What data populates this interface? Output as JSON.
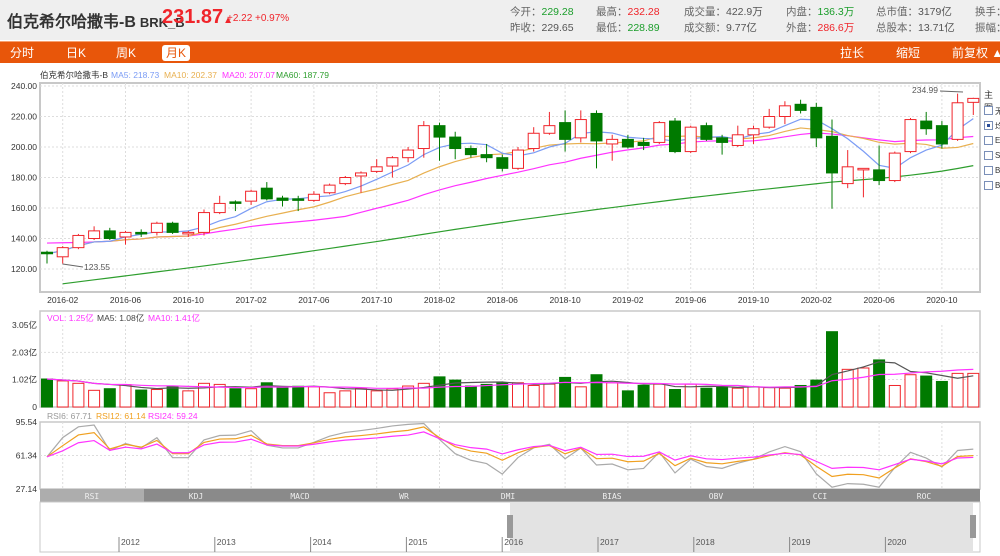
{
  "header": {
    "name": "伯克希尔哈撒韦-B",
    "code": "BRK_B",
    "price": "231.87",
    "arrow": "▲",
    "change": "+2.22",
    "change_pct": "+0.97%",
    "stats": [
      {
        "label": "今开：",
        "value": "229.28",
        "color": "g"
      },
      {
        "label": "昨收：",
        "value": "229.65",
        "color": "k"
      },
      {
        "label": "最高：",
        "value": "232.28",
        "color": "r"
      },
      {
        "label": "最低：",
        "value": "228.89",
        "color": "g"
      },
      {
        "label": "成交量：",
        "value": "422.9万",
        "color": "k"
      },
      {
        "label": "成交额：",
        "value": "9.77亿",
        "color": "k"
      },
      {
        "label": "内盘：",
        "value": "136.3万",
        "color": "g"
      },
      {
        "label": "外盘：",
        "value": "286.6万",
        "color": "r"
      },
      {
        "label": "总市值：",
        "value": "3179亿",
        "color": "k"
      },
      {
        "label": "总股本：",
        "value": "13.71亿",
        "color": "k"
      },
      {
        "label": "换手：",
        "value": "",
        "color": "k"
      },
      {
        "label": "振幅：",
        "value": "",
        "color": "k"
      }
    ]
  },
  "toolbar": {
    "tabs": [
      "分时",
      "日K",
      "周K",
      "月K"
    ],
    "active": 3,
    "stretch": "拉长",
    "shrink": "缩短",
    "adjust": "前复权 ▲"
  },
  "side": {
    "title": "主图",
    "options": [
      "无",
      "均",
      "EX",
      "SA",
      "BO",
      "BB"
    ],
    "checked": 1
  },
  "legend": {
    "name": "伯克希尔哈撒韦-B",
    "ma5": "MA5: 218.73",
    "ma10": "MA10: 202.37",
    "ma20": "MA20: 207.07",
    "ma60": "MA60: 187.79"
  },
  "vol_legend": {
    "vol": "VOL: 1.25亿",
    "ma5": "MA5: 1.08亿",
    "ma10": "MA10: 1.41亿"
  },
  "rsi_legend": {
    "rsi6": "RSI6: 67.71",
    "rsi12": "RSI12: 61.14",
    "rsi24": "RSI24: 59.24"
  },
  "indicators": [
    "RSI",
    "KDJ",
    "MACD",
    "WR",
    "DMI",
    "BIAS",
    "OBV",
    "CCI",
    "ROC"
  ],
  "navigator_years": [
    "2012",
    "2013",
    "2014",
    "2015",
    "2016",
    "2017",
    "2018",
    "2019",
    "2020"
  ],
  "colors": {
    "up": "#f0252b",
    "down": "#007a00",
    "ma5": "#7b9cf5",
    "ma10": "#e8b050",
    "ma20": "#ff33ff",
    "ma60": "#2e9e2e",
    "accent": "#e8560a"
  },
  "chart_data": {
    "type": "candlestick",
    "x_ticks": [
      "2016-02",
      "2016-06",
      "2016-10",
      "2017-02",
      "2017-06",
      "2017-10",
      "2018-02",
      "2018-06",
      "2018-10",
      "2019-02",
      "2019-06",
      "2019-10",
      "2020-02",
      "2020-06",
      "2020-10"
    ],
    "y_ticks": [
      "240.00",
      "220.00",
      "200.00",
      "180.00",
      "160.00",
      "140.00",
      "120.00"
    ],
    "ylim": [
      110,
      240
    ],
    "annotations": {
      "max": "234.99",
      "min": "123.55"
    },
    "ohlc": [
      [
        131,
        130,
        132,
        123.6
      ],
      [
        128,
        134,
        135,
        123.55
      ],
      [
        134,
        142,
        143,
        133
      ],
      [
        140,
        145,
        148,
        139
      ],
      [
        145,
        140,
        147,
        139
      ],
      [
        141,
        144,
        145,
        136
      ],
      [
        144,
        143,
        146,
        141
      ],
      [
        144,
        150,
        151,
        142
      ],
      [
        150,
        144,
        151,
        143
      ],
      [
        143,
        144,
        145,
        141
      ],
      [
        144,
        157,
        159,
        142
      ],
      [
        157,
        163,
        168,
        156
      ],
      [
        164,
        163.5,
        165,
        158
      ],
      [
        164.5,
        171,
        172,
        162
      ],
      [
        173,
        166,
        177,
        165
      ],
      [
        166.5,
        165,
        168,
        161
      ],
      [
        166,
        165,
        168,
        158
      ],
      [
        165,
        169,
        171,
        164
      ],
      [
        170,
        175,
        176,
        169
      ],
      [
        176,
        180,
        181,
        175
      ],
      [
        181,
        183,
        184,
        170
      ],
      [
        184,
        187,
        192,
        183
      ],
      [
        187.5,
        193,
        194,
        180
      ],
      [
        193,
        198,
        200,
        190
      ],
      [
        199,
        214,
        217,
        193
      ],
      [
        214,
        206.5,
        216,
        191
      ],
      [
        206.5,
        199,
        210,
        192
      ],
      [
        199,
        195,
        201,
        193
      ],
      [
        195,
        193,
        202,
        190
      ],
      [
        193,
        186,
        195,
        184
      ],
      [
        186,
        198,
        200,
        185
      ],
      [
        199,
        209,
        213,
        197
      ],
      [
        209,
        214,
        223,
        208
      ],
      [
        216,
        205,
        224,
        197
      ],
      [
        206,
        218,
        224,
        203
      ],
      [
        222,
        204,
        224,
        186
      ],
      [
        202,
        205,
        208,
        191
      ],
      [
        205,
        200,
        208,
        199
      ],
      [
        203,
        201,
        206,
        198
      ],
      [
        203,
        216,
        217,
        202
      ],
      [
        217,
        197,
        219,
        196
      ],
      [
        197,
        213,
        214,
        196
      ],
      [
        214,
        205,
        216,
        204
      ],
      [
        206,
        203,
        208,
        195
      ],
      [
        201,
        208,
        214,
        200
      ],
      [
        208,
        212,
        214,
        202
      ],
      [
        213,
        220,
        225,
        212
      ],
      [
        220,
        227,
        230,
        215
      ],
      [
        228,
        224,
        231,
        222
      ],
      [
        226,
        206,
        229,
        200
      ],
      [
        207,
        183,
        218,
        159.5
      ],
      [
        176,
        187,
        198,
        173
      ],
      [
        185,
        186,
        186,
        167
      ],
      [
        185,
        178,
        201,
        175
      ],
      [
        178,
        196,
        197,
        177
      ],
      [
        197,
        218,
        219,
        196
      ],
      [
        217,
        212,
        223,
        208
      ],
      [
        214,
        202,
        217,
        199
      ],
      [
        205,
        229,
        234.99,
        204
      ],
      [
        229.28,
        231.87,
        232.28,
        221
      ]
    ],
    "ma60": [
      109,
      110.3,
      111.6,
      112.9,
      114.2,
      115.5,
      116.8,
      118.1,
      119.4,
      120.7,
      122,
      123.4,
      124.8,
      126.2,
      127.6,
      129,
      130.5,
      132,
      133.5,
      135,
      136.5,
      138,
      139.6,
      141.2,
      142.8,
      144.4,
      146,
      147.5,
      149,
      150.5,
      152,
      153.4,
      154.8,
      156.2,
      157.6,
      159,
      160.3,
      161.6,
      162.9,
      164.2,
      165.5,
      166.7,
      167.9,
      169.1,
      170.3,
      171.5,
      172.6,
      173.7,
      174.8,
      175.9,
      177,
      177.8,
      178.6,
      179.4,
      180.4,
      181.5,
      182.8,
      184.2,
      185.9,
      187.79
    ],
    "volume_ticks": [
      "3.05亿",
      "2.03亿",
      "1.02亿",
      "0"
    ],
    "volume": [
      1.04,
      0.97,
      0.88,
      0.62,
      0.68,
      0.83,
      0.63,
      0.65,
      0.78,
      0.6,
      0.88,
      0.84,
      0.68,
      0.68,
      0.9,
      0.75,
      0.77,
      0.75,
      0.53,
      0.6,
      0.69,
      0.6,
      0.68,
      0.78,
      0.88,
      1.12,
      1.0,
      0.78,
      0.84,
      0.9,
      0.9,
      0.8,
      0.85,
      1.1,
      0.75,
      1.2,
      0.9,
      0.6,
      0.8,
      0.85,
      0.65,
      0.85,
      0.7,
      0.75,
      0.7,
      0.75,
      0.72,
      0.7,
      0.8,
      1.0,
      2.8,
      1.4,
      1.45,
      1.75,
      0.8,
      1.2,
      1.15,
      0.95,
      1.25,
      1.25
    ],
    "volume_ylim": [
      0,
      3.05
    ],
    "rsi_ticks": [
      "95.54",
      "61.34",
      "27.14"
    ],
    "rsi_ylim": [
      27.14,
      95.54
    ]
  }
}
